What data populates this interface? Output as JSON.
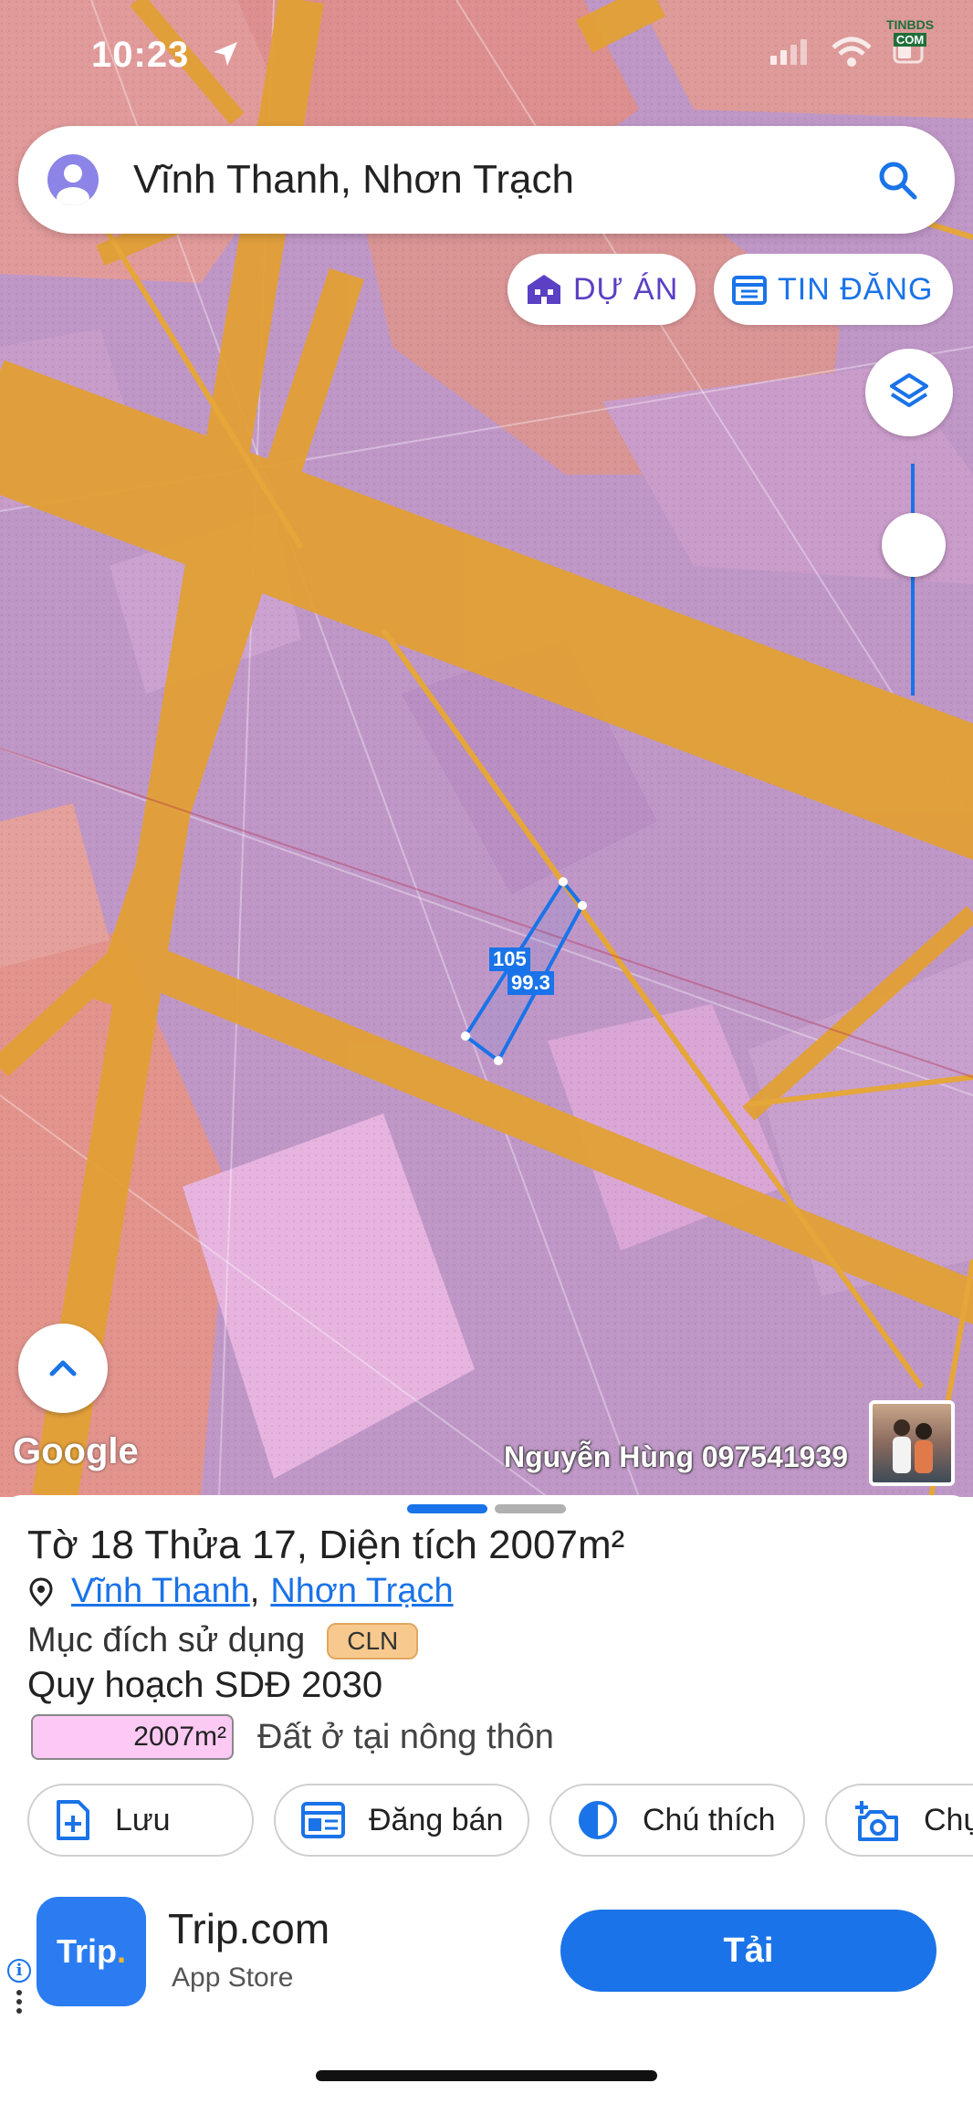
{
  "status_bar": {
    "time": "10:23"
  },
  "watermark_logo": {
    "top": "TINBDS",
    "bottom": "COM"
  },
  "search": {
    "query": "Vĩnh Thanh, Nhơn Trạch"
  },
  "filters": {
    "du_an": "DỰ ÁN",
    "tin_dang": "TIN ĐĂNG"
  },
  "map": {
    "parcel_labels": {
      "side_a": "105",
      "side_b": "99.3"
    },
    "google_logo": "Google",
    "watermark": "Nguyễn Hùng 097541939",
    "colors": {
      "residential": "#c59ccf",
      "agricultural": "#e89a98",
      "roads": "#e3a23a",
      "parcel_outline": "#1a73e8"
    }
  },
  "parcel": {
    "title": "Tờ 18 Thửa 17, Diện tích 2007m²",
    "ward": "Vĩnh Thanh",
    "district": "Nhơn Trạch",
    "separator": ",",
    "purpose_label": "Mục đích sử dụng",
    "purpose_code": "CLN",
    "planning_title": "Quy hoạch SDĐ 2030",
    "planning_area": "2007m²",
    "planning_desc": "Đất ở tại nông thôn"
  },
  "actions": {
    "save": "Lưu",
    "post": "Đăng bán",
    "legend": "Chú thích",
    "capture": "Chụ"
  },
  "ad": {
    "logo": "Trip",
    "logo_dot": ".",
    "name": "Trip.com",
    "store": "App Store",
    "cta": "Tải",
    "info": "i"
  }
}
